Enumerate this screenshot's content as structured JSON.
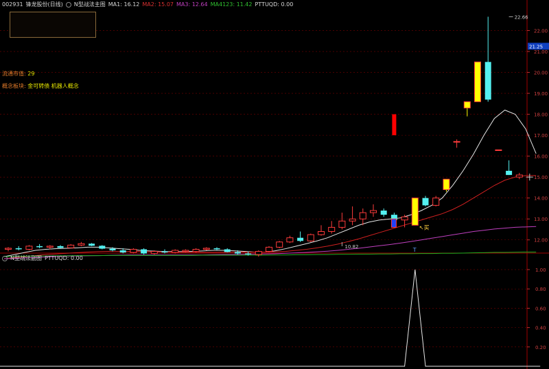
{
  "header": {
    "code": "002931",
    "name": "锋龙股份(日线)",
    "indicator": "N型战法主图",
    "ma1": "MA1: 16.12",
    "ma2": "MA2: 15.07",
    "ma3": "MA3: 12.64",
    "ma4": "MA4123: 11.42",
    "pttu": "PTTUQD: 0.00"
  },
  "info": {
    "float_label": "流通市值:",
    "float_value": "29",
    "concept_label": "概念板块:",
    "concept_value": "金可转债 机器人概念"
  },
  "sub_header": {
    "title": "N型战法副图",
    "pttu": "PTTUQD: 0.00"
  },
  "colors": {
    "up": "#ff3b3b",
    "down": "#54f0f0",
    "yellow": "#ffff00",
    "red_solid": "#ff0000",
    "ma1": "#e6e6e6",
    "ma2": "#d02020",
    "ma3": "#c040c0",
    "ma4": "#20b020",
    "axis_text": "#d04040",
    "grid": "#7a0000"
  },
  "chart_data": [
    {
      "type": "candlestick",
      "title": "N型战法主图",
      "ylim": [
        11.5,
        23.0
      ],
      "y_ticks": [
        12.0,
        13.0,
        14.0,
        15.0,
        16.0,
        17.0,
        18.0,
        19.0,
        20.0,
        21.0,
        22.0
      ],
      "current_price_label": "21.25",
      "annotations": [
        {
          "text": "22.66",
          "value": 22.66,
          "bar": 48
        },
        {
          "text": "10.82",
          "value": 10.82,
          "bar": 32
        },
        {
          "text": "买",
          "value": 12.6,
          "bar": 39
        },
        {
          "text": "T",
          "bar": 39
        }
      ],
      "candles": [
        {
          "o": 11.55,
          "h": 11.65,
          "l": 11.45,
          "c": 11.6,
          "s": "up"
        },
        {
          "o": 11.6,
          "h": 11.7,
          "l": 11.5,
          "c": 11.55,
          "s": "down"
        },
        {
          "o": 11.55,
          "h": 11.75,
          "l": 11.5,
          "c": 11.7,
          "s": "up"
        },
        {
          "o": 11.7,
          "h": 11.8,
          "l": 11.6,
          "c": 11.65,
          "s": "down"
        },
        {
          "o": 11.65,
          "h": 11.75,
          "l": 11.55,
          "c": 11.7,
          "s": "up"
        },
        {
          "o": 11.7,
          "h": 11.75,
          "l": 11.6,
          "c": 11.62,
          "s": "down"
        },
        {
          "o": 11.62,
          "h": 11.8,
          "l": 11.6,
          "c": 11.75,
          "s": "up"
        },
        {
          "o": 11.75,
          "h": 11.9,
          "l": 11.7,
          "c": 11.82,
          "s": "up"
        },
        {
          "o": 11.82,
          "h": 11.85,
          "l": 11.7,
          "c": 11.72,
          "s": "down"
        },
        {
          "o": 11.72,
          "h": 11.75,
          "l": 11.55,
          "c": 11.58,
          "s": "down"
        },
        {
          "o": 11.58,
          "h": 11.65,
          "l": 11.45,
          "c": 11.5,
          "s": "down"
        },
        {
          "o": 11.5,
          "h": 11.6,
          "l": 11.35,
          "c": 11.4,
          "s": "down"
        },
        {
          "o": 11.4,
          "h": 11.6,
          "l": 11.35,
          "c": 11.55,
          "s": "up"
        },
        {
          "o": 11.55,
          "h": 11.6,
          "l": 11.3,
          "c": 11.35,
          "s": "down"
        },
        {
          "o": 11.35,
          "h": 11.5,
          "l": 11.3,
          "c": 11.45,
          "s": "up"
        },
        {
          "o": 11.45,
          "h": 11.55,
          "l": 11.35,
          "c": 11.4,
          "s": "down"
        },
        {
          "o": 11.4,
          "h": 11.55,
          "l": 11.35,
          "c": 11.5,
          "s": "up"
        },
        {
          "o": 11.5,
          "h": 11.55,
          "l": 11.4,
          "c": 11.45,
          "s": "up"
        },
        {
          "o": 11.45,
          "h": 11.6,
          "l": 11.4,
          "c": 11.55,
          "s": "up"
        },
        {
          "o": 11.55,
          "h": 11.65,
          "l": 11.5,
          "c": 11.6,
          "s": "up"
        },
        {
          "o": 11.6,
          "h": 11.65,
          "l": 11.5,
          "c": 11.55,
          "s": "down"
        },
        {
          "o": 11.55,
          "h": 11.6,
          "l": 11.4,
          "c": 11.42,
          "s": "down"
        },
        {
          "o": 11.42,
          "h": 11.5,
          "l": 11.3,
          "c": 11.35,
          "s": "down"
        },
        {
          "o": 11.35,
          "h": 11.45,
          "l": 11.25,
          "c": 11.3,
          "s": "down"
        },
        {
          "o": 11.3,
          "h": 11.5,
          "l": 11.2,
          "c": 11.45,
          "s": "up"
        },
        {
          "o": 11.45,
          "h": 11.7,
          "l": 11.4,
          "c": 11.65,
          "s": "up"
        },
        {
          "o": 11.65,
          "h": 11.95,
          "l": 11.6,
          "c": 11.9,
          "s": "up"
        },
        {
          "o": 11.9,
          "h": 12.2,
          "l": 11.85,
          "c": 12.1,
          "s": "up"
        },
        {
          "o": 12.1,
          "h": 12.4,
          "l": 11.9,
          "c": 11.95,
          "s": "down"
        },
        {
          "o": 11.95,
          "h": 12.3,
          "l": 11.9,
          "c": 12.25,
          "s": "up"
        },
        {
          "o": 12.25,
          "h": 12.7,
          "l": 12.2,
          "c": 12.4,
          "s": "up"
        },
        {
          "o": 12.4,
          "h": 12.9,
          "l": 12.3,
          "c": 12.6,
          "s": "up"
        },
        {
          "o": 12.6,
          "h": 13.3,
          "l": 12.5,
          "c": 12.9,
          "s": "up"
        },
        {
          "o": 12.9,
          "h": 13.6,
          "l": 12.7,
          "c": 13.0,
          "s": "up"
        },
        {
          "o": 13.0,
          "h": 13.5,
          "l": 12.7,
          "c": 13.3,
          "s": "up"
        },
        {
          "o": 13.3,
          "h": 13.7,
          "l": 13.1,
          "c": 13.4,
          "s": "up"
        },
        {
          "o": 13.4,
          "h": 13.5,
          "l": 13.1,
          "c": 13.2,
          "s": "down"
        },
        {
          "o": 13.2,
          "h": 13.3,
          "l": 12.9,
          "c": 12.95,
          "s": "down"
        },
        {
          "o": 12.95,
          "h": 13.2,
          "l": 12.6,
          "c": 13.1,
          "s": "up"
        },
        {
          "o": 12.7,
          "h": 14.0,
          "l": 12.7,
          "c": 14.0,
          "s": "yellow"
        },
        {
          "o": 14.0,
          "h": 14.1,
          "l": 13.6,
          "c": 13.65,
          "s": "down"
        },
        {
          "o": 13.65,
          "h": 14.1,
          "l": 13.6,
          "c": 14.0,
          "s": "up"
        },
        {
          "o": 14.4,
          "h": 14.9,
          "l": 14.3,
          "c": 14.9,
          "s": "yellow"
        },
        {
          "o": 16.7,
          "h": 16.8,
          "l": 16.4,
          "c": 16.7,
          "s": "up"
        },
        {
          "o": 18.3,
          "h": 18.6,
          "l": 17.9,
          "c": 18.6,
          "s": "yellow"
        },
        {
          "o": 18.6,
          "h": 20.5,
          "l": 18.6,
          "c": 20.5,
          "s": "yellow"
        },
        {
          "o": 20.5,
          "h": 22.66,
          "l": 18.6,
          "c": 18.7,
          "s": "down"
        },
        {
          "o": 16.3,
          "h": 16.3,
          "l": 16.3,
          "c": 16.3,
          "s": "up"
        },
        {
          "o": 15.3,
          "h": 15.8,
          "l": 15.1,
          "c": 15.1,
          "s": "down"
        },
        {
          "o": 15.1,
          "h": 15.2,
          "l": 14.9,
          "c": 15.0,
          "s": "up"
        }
      ],
      "red_signal": {
        "o": 17.0,
        "c": 18.0
      },
      "series": [
        {
          "name": "MA1",
          "values": [
            11.2,
            11.3,
            11.4,
            11.5,
            11.55,
            11.58,
            11.6,
            11.62,
            11.65,
            11.65,
            11.62,
            11.58,
            11.55,
            11.5,
            11.47,
            11.45,
            11.44,
            11.44,
            11.45,
            11.47,
            11.5,
            11.5,
            11.48,
            11.45,
            11.42,
            11.42,
            11.48,
            11.58,
            11.7,
            11.82,
            11.95,
            12.1,
            12.3,
            12.5,
            12.7,
            12.85,
            12.95,
            13.0,
            13.05,
            13.2,
            13.4,
            13.65,
            14.0,
            14.6,
            15.3,
            16.1,
            17.0,
            17.8,
            18.2,
            18.0,
            17.3,
            16.12
          ]
        },
        {
          "name": "MA2",
          "values": [
            11.1,
            11.15,
            11.2,
            11.25,
            11.3,
            11.33,
            11.36,
            11.39,
            11.42,
            11.44,
            11.45,
            11.45,
            11.45,
            11.45,
            11.44,
            11.43,
            11.42,
            11.41,
            11.4,
            11.4,
            11.4,
            11.41,
            11.42,
            11.42,
            11.42,
            11.42,
            11.43,
            11.45,
            11.5,
            11.55,
            11.62,
            11.7,
            11.8,
            11.92,
            12.05,
            12.2,
            12.35,
            12.5,
            12.65,
            12.8,
            12.95,
            13.1,
            13.25,
            13.45,
            13.7,
            14.0,
            14.3,
            14.6,
            14.85,
            15.0,
            15.07,
            15.07
          ]
        },
        {
          "name": "MA3",
          "values": [
            11.1,
            11.12,
            11.14,
            11.16,
            11.18,
            11.2,
            11.22,
            11.23,
            11.24,
            11.25,
            11.26,
            11.27,
            11.28,
            11.28,
            11.28,
            11.28,
            11.28,
            11.28,
            11.28,
            11.28,
            11.29,
            11.3,
            11.3,
            11.31,
            11.32,
            11.33,
            11.34,
            11.36,
            11.38,
            11.4,
            11.43,
            11.46,
            11.5,
            11.55,
            11.6,
            11.66,
            11.72,
            11.78,
            11.85,
            11.92,
            12.0,
            12.08,
            12.16,
            12.24,
            12.32,
            12.4,
            12.46,
            12.52,
            12.56,
            12.6,
            12.62,
            12.64
          ]
        },
        {
          "name": "MA4123",
          "values": [
            11.2,
            11.21,
            11.22,
            11.23,
            11.23,
            11.24,
            11.24,
            11.25,
            11.25,
            11.25,
            11.26,
            11.26,
            11.26,
            11.26,
            11.26,
            11.26,
            11.26,
            11.26,
            11.26,
            11.27,
            11.27,
            11.27,
            11.27,
            11.27,
            11.27,
            11.27,
            11.28,
            11.28,
            11.29,
            11.29,
            11.3,
            11.3,
            11.31,
            11.31,
            11.32,
            11.32,
            11.33,
            11.33,
            11.34,
            11.34,
            11.35,
            11.35,
            11.36,
            11.36,
            11.37,
            11.38,
            11.39,
            11.4,
            11.4,
            11.41,
            11.42,
            11.42
          ]
        }
      ]
    },
    {
      "type": "line",
      "title": "N型战法副图",
      "ylim": [
        0.0,
        1.05
      ],
      "y_ticks": [
        0.2,
        0.4,
        0.6,
        0.8,
        1.0
      ],
      "series": [
        {
          "name": "PTTUQD",
          "values": [
            0,
            0,
            0,
            0,
            0,
            0,
            0,
            0,
            0,
            0,
            0,
            0,
            0,
            0,
            0,
            0,
            0,
            0,
            0,
            0,
            0,
            0,
            0,
            0,
            0,
            0,
            0,
            0,
            0,
            0,
            0,
            0,
            0,
            0,
            0,
            0,
            0,
            0,
            0,
            1,
            0,
            0,
            0,
            0,
            0,
            0,
            0,
            0,
            0,
            0,
            0,
            0
          ]
        }
      ]
    }
  ]
}
